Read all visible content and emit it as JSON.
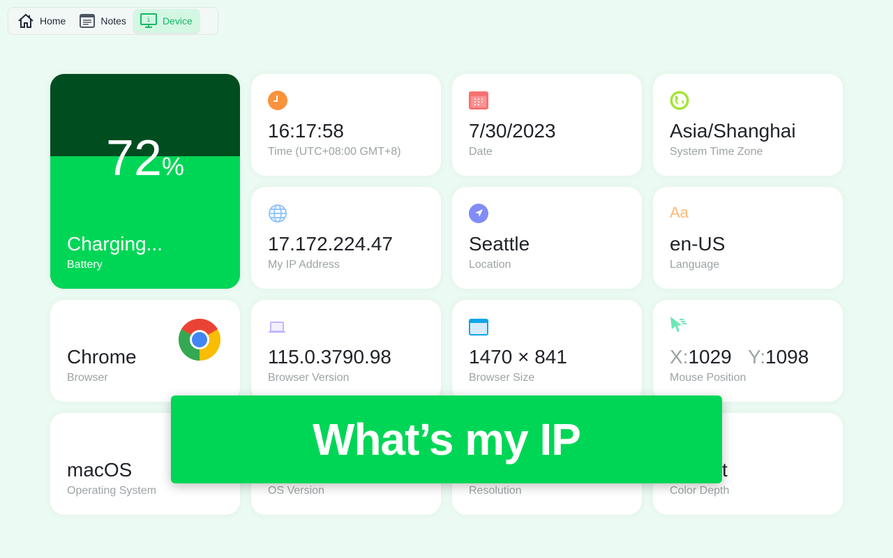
{
  "nav": {
    "items": [
      {
        "label": "Home",
        "icon": "home-icon"
      },
      {
        "label": "Notes",
        "icon": "notes-icon"
      },
      {
        "label": "Device",
        "icon": "monitor-info-icon",
        "active": true
      }
    ]
  },
  "battery": {
    "percent": "72",
    "unit": "%",
    "status": "Charging...",
    "label": "Battery",
    "level": 72
  },
  "cards": {
    "time": {
      "value": "16:17:58",
      "label": "Time (UTC+08:00 GMT+8)"
    },
    "date": {
      "value": "7/30/2023",
      "label": "Date"
    },
    "timezone": {
      "value": "Asia/Shanghai",
      "label": "System Time Zone"
    },
    "ip": {
      "value": "17.172.224.47",
      "label": "My IP Address"
    },
    "location": {
      "value": "Seattle",
      "label": "Location"
    },
    "language": {
      "icon_text": "Aa",
      "value": "en-US",
      "label": "Language"
    },
    "browser": {
      "value": "Chrome",
      "label": "Browser"
    },
    "browser_version": {
      "value": "115.0.3790.98",
      "label": "Browser Version"
    },
    "browser_size": {
      "value": "1470 × 841",
      "label": "Browser Size"
    },
    "mouse": {
      "x_label": "X:",
      "x": "1029",
      "y_label": "Y:",
      "y": "1098",
      "label": "Mouse Position"
    },
    "os": {
      "value": "macOS",
      "label": "Operating System"
    },
    "os_version": {
      "label": "OS Version"
    },
    "resolution": {
      "label": "Resolution"
    },
    "color_depth": {
      "value_partial": "t",
      "label": "Color Depth"
    }
  },
  "banner": {
    "text": "What’s my IP"
  },
  "colors": {
    "accent": "#00d656",
    "battery_dark": "#004d20",
    "background": "#ebfaf2"
  }
}
